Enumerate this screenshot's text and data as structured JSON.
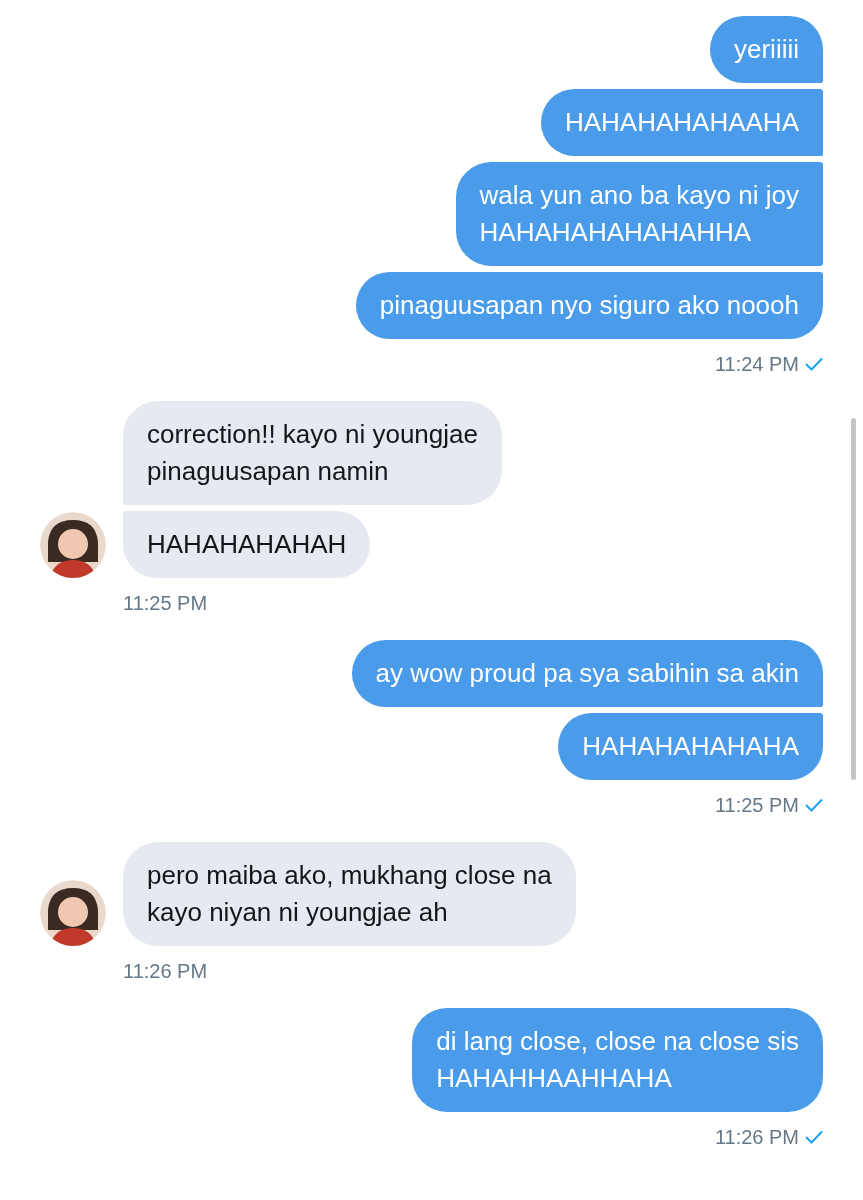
{
  "conversation": [
    {
      "kind": "sent",
      "messages": [
        "yeriiiii",
        "HAHAHAHAHAAHA",
        "wala yun ano ba kayo ni joy\nHAHAHAHAHAHAHHA",
        "pinaguusapan nyo siguro ako noooh"
      ],
      "time": "11:24 PM",
      "read": true
    },
    {
      "kind": "received",
      "messages": [
        "correction!! kayo ni youngjae\npinaguusapan namin",
        "HAHAHAHAHAH"
      ],
      "time": "11:25 PM"
    },
    {
      "kind": "sent",
      "messages": [
        "ay wow proud pa sya sabihin sa akin",
        "HAHAHAHAHAHA"
      ],
      "time": "11:25 PM",
      "read": true
    },
    {
      "kind": "received",
      "messages": [
        "pero maiba ako, mukhang close na\nkayo niyan ni youngjae ah"
      ],
      "time": "11:26 PM"
    },
    {
      "kind": "sent",
      "messages": [
        "di lang close, close na close sis\nHAHAHHAAHHAHA"
      ],
      "time": "11:26 PM",
      "read": true
    }
  ]
}
